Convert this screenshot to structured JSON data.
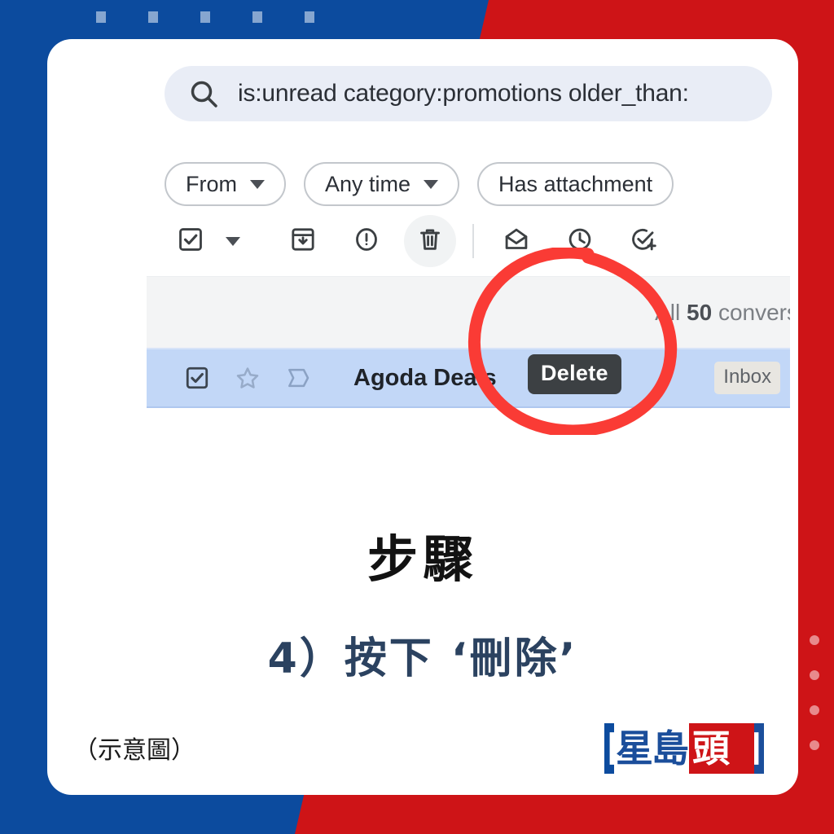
{
  "theme": {
    "blue": "#0c4b9e",
    "red": "#ce1417",
    "card_bg": "#ffffff",
    "annotation_red": "#fa3b35",
    "step_text_color": "#2b4260",
    "mail_row_selected": "#c2d7f7"
  },
  "gmail": {
    "search": {
      "icon": "search-icon",
      "value": "is:unread category:promotions older_than:"
    },
    "filter_chips": [
      {
        "label": "From",
        "has_caret": true
      },
      {
        "label": "Any time",
        "has_caret": true
      },
      {
        "label": "Has attachment",
        "has_caret": false
      }
    ],
    "toolbar": {
      "items": [
        {
          "name": "select-all-checkbox",
          "icon": "checkbox-checked-icon"
        },
        {
          "name": "select-all-dropdown",
          "icon": "caret-down-icon"
        },
        {
          "name": "archive-button",
          "icon": "archive-icon"
        },
        {
          "name": "report-spam-button",
          "icon": "report-spam-icon"
        },
        {
          "name": "delete-button",
          "icon": "trash-icon"
        },
        {
          "name": "mark-as-unread-button",
          "icon": "mark-unread-icon"
        },
        {
          "name": "snooze-button",
          "icon": "clock-icon"
        },
        {
          "name": "add-to-tasks-button",
          "icon": "add-task-icon"
        }
      ],
      "tooltip": "Delete"
    },
    "conversation_count": {
      "prefix": "All ",
      "number": "50",
      "suffix": " convers"
    },
    "mail_row": {
      "checkbox": "checkbox-checked-icon",
      "star": "star-outline-icon",
      "important": "important-marker-icon",
      "sender": "Agoda Deals",
      "label_badge": "Inbox"
    }
  },
  "caption": {
    "heading": "步驟",
    "step": "4）按下 ‘刪除’",
    "note": "（示意圖）"
  },
  "logo": {
    "blue_part": "星島",
    "red_part": "頭條"
  },
  "decor": {
    "top_squares": 5,
    "right_dots": 4
  }
}
